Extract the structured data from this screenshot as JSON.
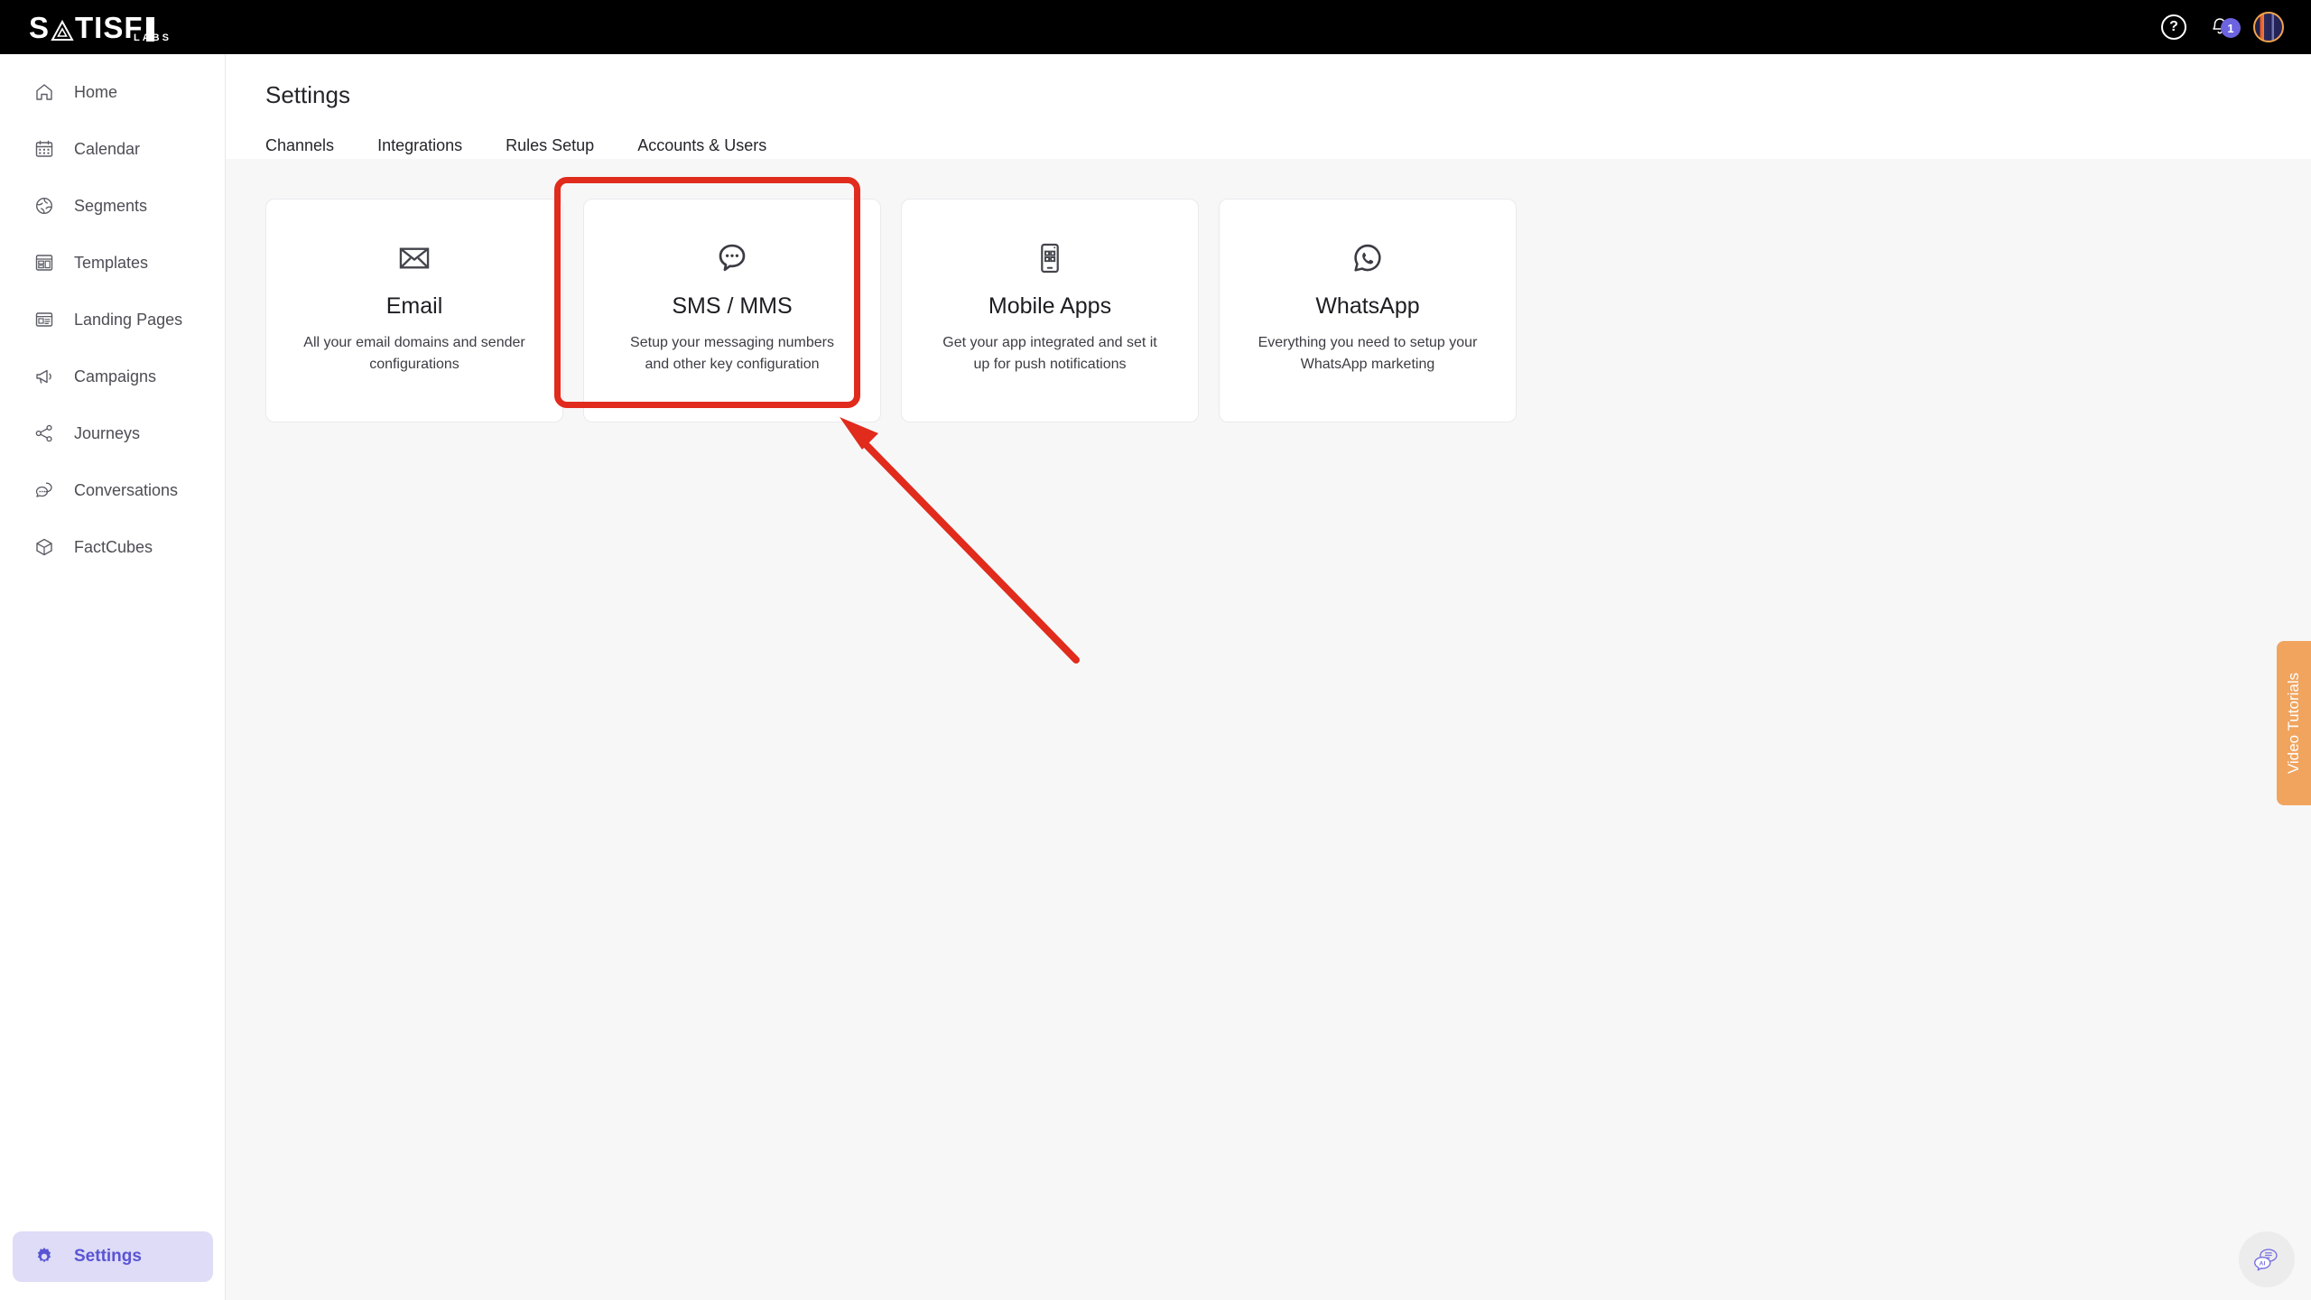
{
  "brand": {
    "logo_text": "SATISFI",
    "logo_sub": "LABS",
    "accent_purple": "#5a54d4",
    "badge_purple": "#6c63e0",
    "annotation_red": "#e02b1d",
    "video_tab_orange": "#f0a45e"
  },
  "topbar": {
    "help_label": "?",
    "notification_count": "1"
  },
  "sidebar": {
    "items": [
      {
        "label": "Home",
        "icon": "home-icon"
      },
      {
        "label": "Calendar",
        "icon": "calendar-icon"
      },
      {
        "label": "Segments",
        "icon": "segments-icon"
      },
      {
        "label": "Templates",
        "icon": "templates-icon"
      },
      {
        "label": "Landing Pages",
        "icon": "landing-pages-icon"
      },
      {
        "label": "Campaigns",
        "icon": "megaphone-icon"
      },
      {
        "label": "Journeys",
        "icon": "share-nodes-icon"
      },
      {
        "label": "Conversations",
        "icon": "chat-bubbles-icon"
      },
      {
        "label": "FactCubes",
        "icon": "cube-icon"
      }
    ],
    "settings": {
      "label": "Settings",
      "icon": "gear-icon",
      "active": true
    }
  },
  "header": {
    "title": "Settings",
    "tabs": [
      {
        "label": "Channels",
        "active": true
      },
      {
        "label": "Integrations",
        "active": false
      },
      {
        "label": "Rules Setup",
        "active": false
      },
      {
        "label": "Accounts & Users",
        "active": false
      }
    ]
  },
  "channels": {
    "cards": [
      {
        "title": "Email",
        "description": "All your email domains and sender configurations",
        "icon": "envelope-icon",
        "highlighted": false
      },
      {
        "title": "SMS / MMS",
        "description": "Setup your messaging numbers and other key configuration",
        "icon": "sms-bubble-icon",
        "highlighted": true
      },
      {
        "title": "Mobile Apps",
        "description": "Get your app integrated and set it up for push notifications",
        "icon": "mobile-phone-icon",
        "highlighted": false
      },
      {
        "title": "WhatsApp",
        "description": "Everything you need to setup your WhatsApp marketing",
        "icon": "whatsapp-icon",
        "highlighted": false
      }
    ]
  },
  "video_tutorials": {
    "label": "Video Tutorials"
  },
  "chat_widget": {
    "icon": "ai-chat-icon",
    "label": "AI"
  }
}
